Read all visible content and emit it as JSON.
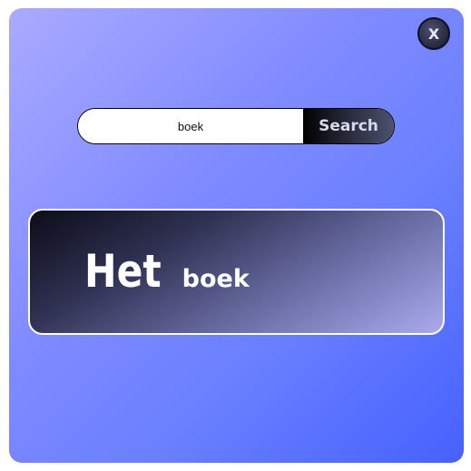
{
  "close_button": {
    "label": "X"
  },
  "search": {
    "value": "boek",
    "button_label": "Search"
  },
  "result": {
    "article": "Het",
    "noun": "boek"
  }
}
